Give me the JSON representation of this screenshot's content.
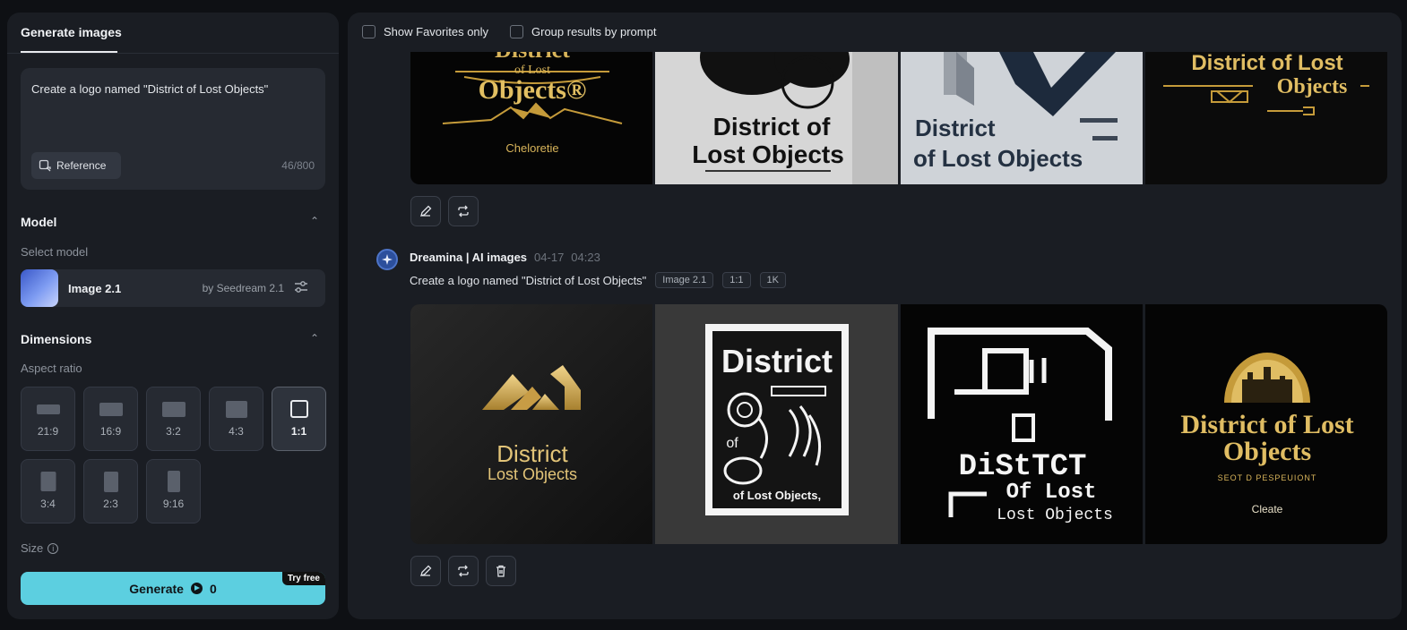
{
  "left_panel": {
    "tab": "Generate images",
    "prompt": "Create a logo named \"District of Lost Objects\"",
    "reference_label": "Reference",
    "char_count": "46/800",
    "model": {
      "section_title": "Model",
      "select_label": "Select model",
      "name": "Image 2.1",
      "by": "by Seedream 2.1"
    },
    "dimensions": {
      "section_title": "Dimensions",
      "aspect_label": "Aspect ratio",
      "ratios": [
        "21:9",
        "16:9",
        "3:2",
        "4:3",
        "1:1",
        "3:4",
        "2:3",
        "9:16"
      ],
      "selected": "1:1",
      "size_label": "Size"
    },
    "generate": {
      "label": "Generate",
      "credits": "0",
      "badge": "Try free"
    }
  },
  "right_panel": {
    "filters": {
      "favorites": "Show Favorites only",
      "group": "Group results by prompt"
    },
    "generation": {
      "source": "Dreamina | AI images",
      "date": "04-17",
      "time": "04:23",
      "prompt": "Create a logo named \"District of Lost Objects\"",
      "tags": [
        "Image 2.1",
        "1:1",
        "1K"
      ]
    },
    "top_images": [
      {
        "lines": [
          "District",
          "of Lost",
          "Objects®",
          "Cheloretie"
        ]
      },
      {
        "lines": [
          "District of",
          "Lost Objects"
        ]
      },
      {
        "lines": [
          "District",
          "of Lost Objects"
        ]
      },
      {
        "lines": [
          "District of Lost",
          "Objects"
        ]
      }
    ],
    "bottom_images": [
      {
        "lines": [
          "District",
          "Lost Objects"
        ]
      },
      {
        "lines": [
          "District",
          "of",
          "of Lost Objects,"
        ]
      },
      {
        "lines": [
          "DiStTCT",
          "Of Lost",
          "Lost Objects"
        ]
      },
      {
        "lines": [
          "District of Lost",
          "Objects",
          "SEOT D PESPEUIONT",
          "Cleate"
        ]
      }
    ]
  },
  "colors": {
    "accent": "#5ccfe0",
    "gold": "#d8b45a",
    "panel": "#1a1d23",
    "background": "#0e1014"
  }
}
